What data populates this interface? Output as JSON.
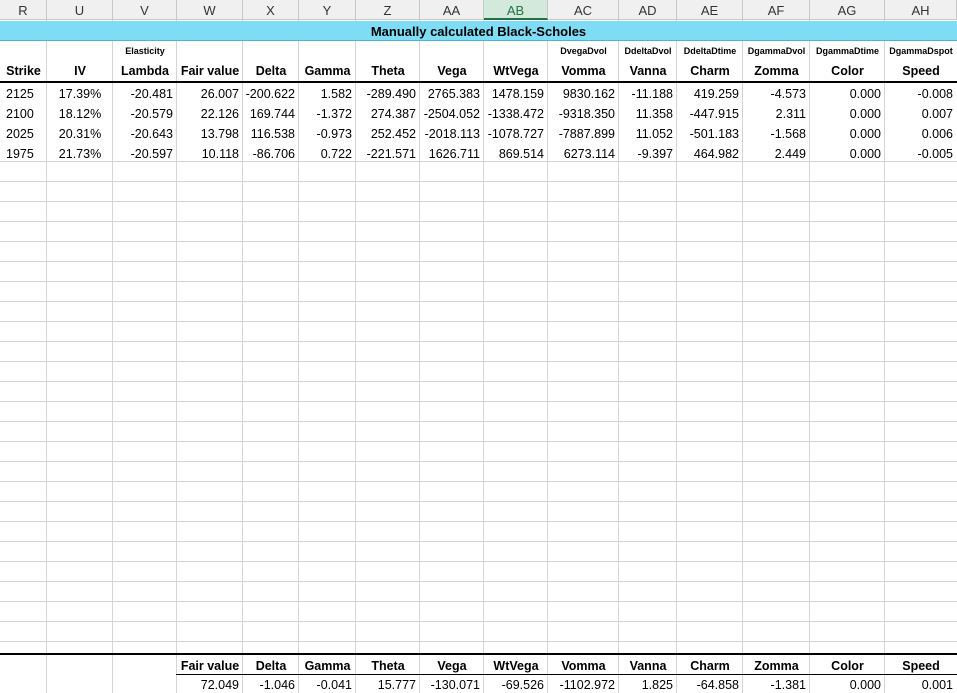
{
  "sheet": {
    "columns": [
      "R",
      "U",
      "V",
      "W",
      "X",
      "Y",
      "Z",
      "AA",
      "AB",
      "AC",
      "AD",
      "AE",
      "AF",
      "AG",
      "AH"
    ],
    "selected_column": "AB",
    "banner_title": "Manually calculated Black-Scholes",
    "banner_color": "#7fdcf5",
    "subheaders": {
      "V": "Elasticity",
      "AC": "DvegaDvol",
      "AD": "DdeltaDvol",
      "AE": "DdeltaDtime",
      "AF": "DgammaDvol",
      "AG": "DgammaDtime",
      "AH": "DgammaDspot"
    },
    "headers": [
      "Strike",
      "IV",
      "Lambda",
      "Fair value",
      "Delta",
      "Gamma",
      "Theta",
      "Vega",
      "WtVega",
      "Vomma",
      "Vanna",
      "Charm",
      "Zomma",
      "Color",
      "Speed"
    ],
    "rows": [
      [
        "2125",
        "17.39%",
        "-20.481",
        "26.007",
        "-200.622",
        "1.582",
        "-289.490",
        "2765.383",
        "1478.159",
        "9830.162",
        "-11.188",
        "419.259",
        "-4.573",
        "0.000",
        "-0.008"
      ],
      [
        "2100",
        "18.12%",
        "-20.579",
        "22.126",
        "169.744",
        "-1.372",
        "274.387",
        "-2504.052",
        "-1338.472",
        "-9318.350",
        "11.358",
        "-447.915",
        "2.311",
        "0.000",
        "0.007"
      ],
      [
        "2025",
        "20.31%",
        "-20.643",
        "13.798",
        "116.538",
        "-0.973",
        "252.452",
        "-2018.113",
        "-1078.727",
        "-7887.899",
        "11.052",
        "-501.183",
        "-1.568",
        "0.000",
        "0.006"
      ],
      [
        "1975",
        "21.73%",
        "-20.597",
        "10.118",
        "-86.706",
        "0.722",
        "-221.571",
        "1626.711",
        "869.514",
        "6273.114",
        "-9.397",
        "464.982",
        "2.449",
        "0.000",
        "-0.005"
      ]
    ],
    "total_headers": [
      "Fair value",
      "Delta",
      "Gamma",
      "Theta",
      "Vega",
      "WtVega",
      "Vomma",
      "Vanna",
      "Charm",
      "Zomma",
      "Color",
      "Speed"
    ],
    "total_values": [
      "72.049",
      "-1.046",
      "-0.041",
      "15.777",
      "-130.071",
      "-69.526",
      "-1102.972",
      "1.825",
      "-64.858",
      "-1.381",
      "0.000",
      "0.001"
    ]
  }
}
